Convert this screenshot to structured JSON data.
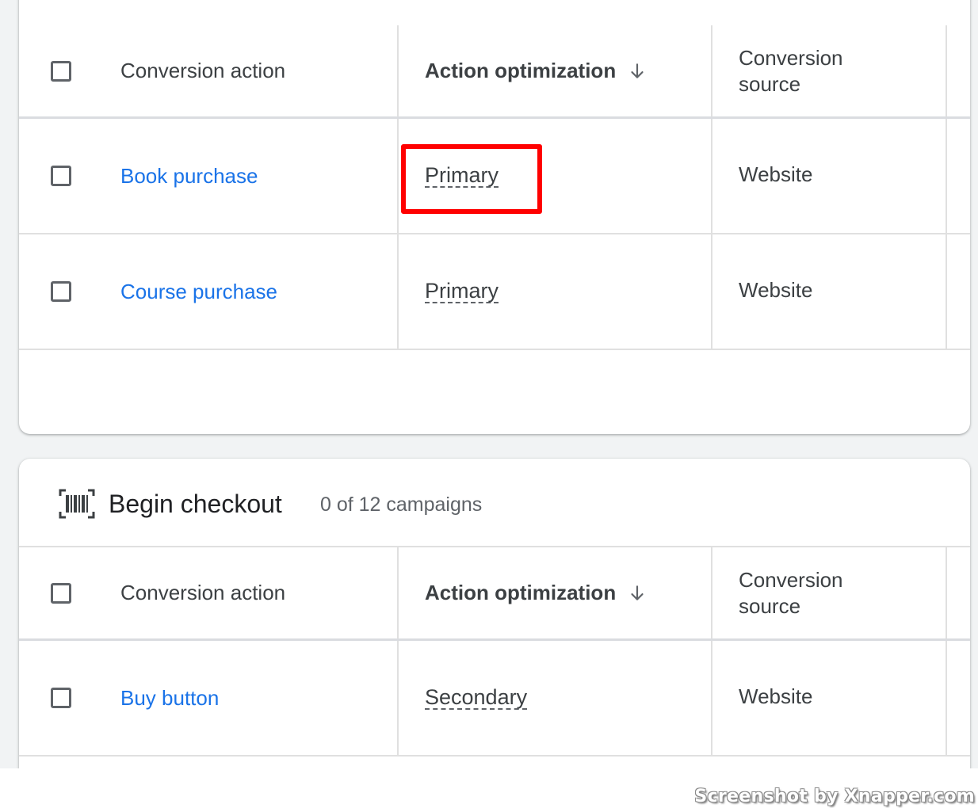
{
  "table_top": {
    "headers": {
      "conversion_action": "Conversion action",
      "action_optimization": "Action optimization",
      "conversion_source_line1": "Conversion",
      "conversion_source_line2": "source"
    },
    "rows": [
      {
        "name": "Book purchase",
        "optimization": "Primary",
        "source": "Website"
      },
      {
        "name": "Course purchase",
        "optimization": "Primary",
        "source": "Website"
      }
    ]
  },
  "section_bottom": {
    "icon": "barcode-icon",
    "title": "Begin checkout",
    "count": "0 of 12 campaigns",
    "headers": {
      "conversion_action": "Conversion action",
      "action_optimization": "Action optimization",
      "conversion_source_line1": "Conversion",
      "conversion_source_line2": "source"
    },
    "rows": [
      {
        "name": "Buy button",
        "optimization": "Secondary",
        "source": "Website"
      }
    ]
  },
  "watermark": "Screenshot by Xnapper.com",
  "colors": {
    "link": "#1a73e8",
    "highlight": "#ff0000",
    "background": "#f1f3f4"
  }
}
